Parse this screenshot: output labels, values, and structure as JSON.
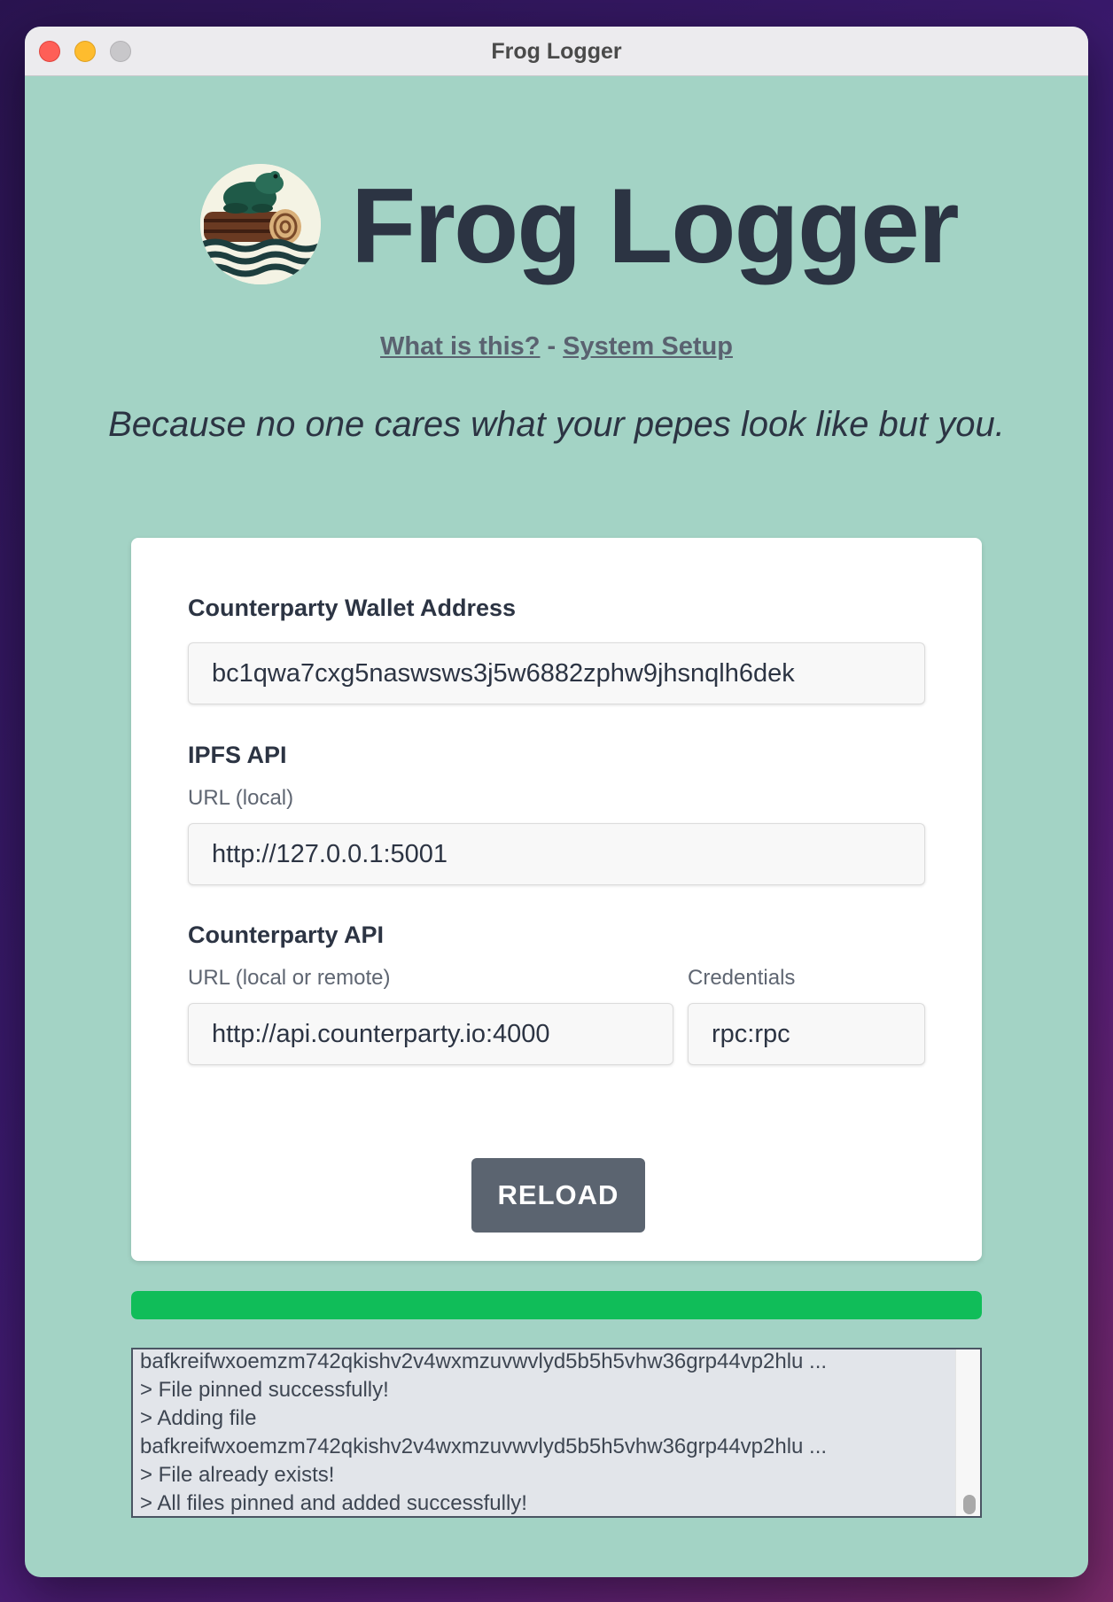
{
  "window": {
    "title": "Frog Logger"
  },
  "header": {
    "brand": "Frog Logger",
    "links": {
      "what_is_this": "What is this?",
      "separator": "-",
      "system_setup": "System Setup"
    },
    "tagline": "Because no one cares what your pepes look like but you."
  },
  "form": {
    "wallet": {
      "label": "Counterparty Wallet Address",
      "value": "bc1qwa7cxg5naswsws3j5w6882zphw9jhsnqlh6dek"
    },
    "ipfs": {
      "label": "IPFS API",
      "url_label": "URL (local)",
      "url_value": "http://127.0.0.1:5001"
    },
    "counterparty": {
      "label": "Counterparty API",
      "url_label": "URL (local or remote)",
      "url_value": "http://api.counterparty.io:4000",
      "credentials_label": "Credentials",
      "credentials_value": "rpc:rpc"
    },
    "reload_label": "RELOAD"
  },
  "progress": {
    "value": 1.0,
    "color": "#10bd59"
  },
  "log": {
    "lines": [
      "bafkreifwxoemzm742qkishv2v4wxmzuvwvlyd5b5h5vhw36grp44vp2hlu ...",
      "> File pinned successfully!",
      "> Adding file",
      "bafkreifwxoemzm742qkishv2v4wxmzuvwvlyd5b5h5vhw36grp44vp2hlu ...",
      "> File already exists!",
      "> All files pinned and added successfully!"
    ]
  },
  "colors": {
    "background": "#a3d3c5",
    "text": "#2c3443",
    "button": "#5b6470"
  }
}
